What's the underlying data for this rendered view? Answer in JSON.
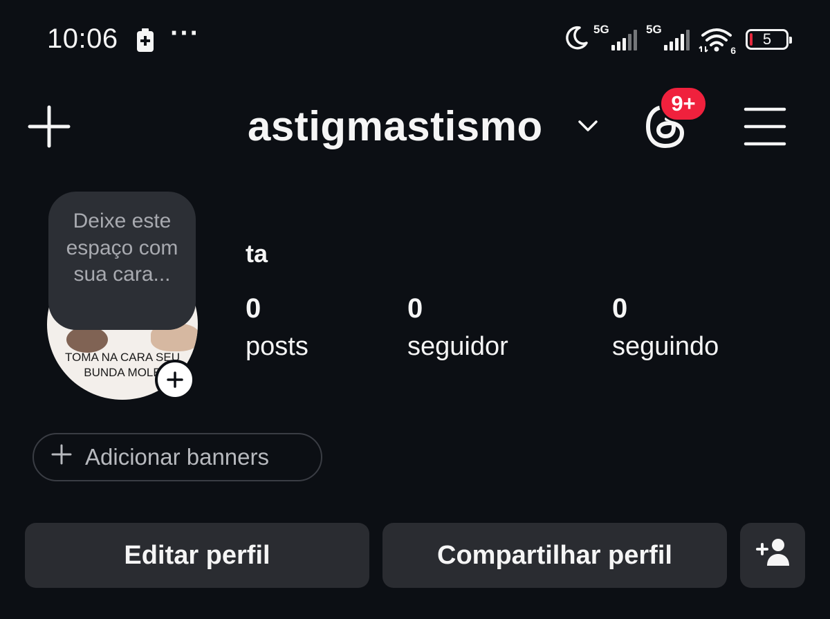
{
  "status_bar": {
    "time": "10:06",
    "dots": "···",
    "network_1": "5G",
    "network_2": "5G",
    "wifi_badge": "6",
    "battery_level": "5"
  },
  "header": {
    "username": "astigmastismo",
    "notification_badge": "9+"
  },
  "profile": {
    "note_text": "Deixe este espaço com sua cara...",
    "avatar_caption": "TOMA NA CARA SEU BUNDA MOLE",
    "full_name": "ta",
    "stats": [
      {
        "value": "0",
        "label": "posts"
      },
      {
        "value": "0",
        "label": "seguidor"
      },
      {
        "value": "0",
        "label": "seguindo"
      }
    ]
  },
  "banners_label": "Adicionar banners",
  "buttons": {
    "edit_profile": "Editar perfil",
    "share_profile": "Compartilhar perfil"
  },
  "colors": {
    "background": "#0c0f14",
    "badge": "#f0213d",
    "button_bg": "#2a2c31",
    "note_bg": "#2c2f35"
  }
}
